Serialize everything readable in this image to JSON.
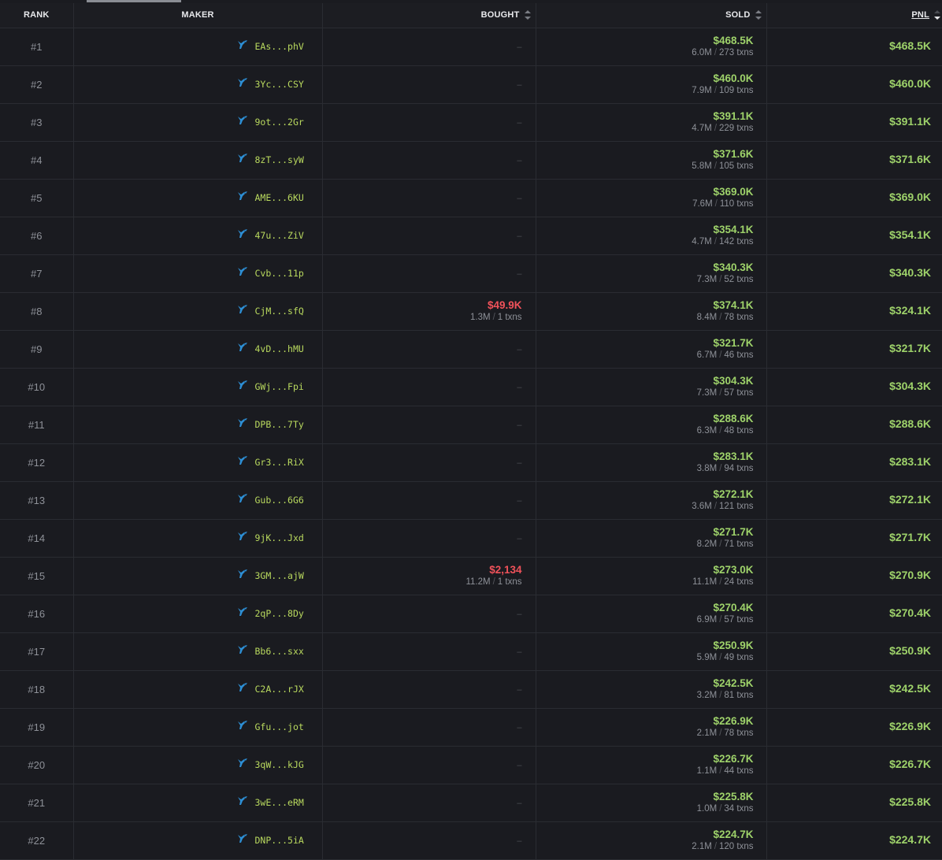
{
  "headers": {
    "rank": "RANK",
    "maker": "MAKER",
    "bought": "BOUGHT",
    "sold": "SOLD",
    "pnl": "PNL"
  },
  "icons": {
    "maker": "whale-icon",
    "sort": "sort-arrows-icon"
  },
  "colors": {
    "background": "#1a1b20",
    "positive": "#9ed26a",
    "negative": "#f0525a",
    "address": "#b9d95e",
    "whale_icon": "#2d8fd5"
  },
  "txn_suffix": "txns",
  "rows": [
    {
      "rank": "#1",
      "maker": "EAs...phV",
      "bought": null,
      "sold": {
        "amount": "$468.5K",
        "tokens": "6.0M",
        "txns": "273"
      },
      "pnl": "$468.5K"
    },
    {
      "rank": "#2",
      "maker": "3Yc...CSY",
      "bought": null,
      "sold": {
        "amount": "$460.0K",
        "tokens": "7.9M",
        "txns": "109"
      },
      "pnl": "$460.0K"
    },
    {
      "rank": "#3",
      "maker": "9ot...2Gr",
      "bought": null,
      "sold": {
        "amount": "$391.1K",
        "tokens": "4.7M",
        "txns": "229"
      },
      "pnl": "$391.1K"
    },
    {
      "rank": "#4",
      "maker": "8zT...syW",
      "bought": null,
      "sold": {
        "amount": "$371.6K",
        "tokens": "5.8M",
        "txns": "105"
      },
      "pnl": "$371.6K"
    },
    {
      "rank": "#5",
      "maker": "AME...6KU",
      "bought": null,
      "sold": {
        "amount": "$369.0K",
        "tokens": "7.6M",
        "txns": "110"
      },
      "pnl": "$369.0K"
    },
    {
      "rank": "#6",
      "maker": "47u...ZiV",
      "bought": null,
      "sold": {
        "amount": "$354.1K",
        "tokens": "4.7M",
        "txns": "142"
      },
      "pnl": "$354.1K"
    },
    {
      "rank": "#7",
      "maker": "Cvb...11p",
      "bought": null,
      "sold": {
        "amount": "$340.3K",
        "tokens": "7.3M",
        "txns": "52"
      },
      "pnl": "$340.3K"
    },
    {
      "rank": "#8",
      "maker": "CjM...sfQ",
      "bought": {
        "amount": "$49.9K",
        "tokens": "1.3M",
        "txns": "1"
      },
      "sold": {
        "amount": "$374.1K",
        "tokens": "8.4M",
        "txns": "78"
      },
      "pnl": "$324.1K"
    },
    {
      "rank": "#9",
      "maker": "4vD...hMU",
      "bought": null,
      "sold": {
        "amount": "$321.7K",
        "tokens": "6.7M",
        "txns": "46"
      },
      "pnl": "$321.7K"
    },
    {
      "rank": "#10",
      "maker": "GWj...Fpi",
      "bought": null,
      "sold": {
        "amount": "$304.3K",
        "tokens": "7.3M",
        "txns": "57"
      },
      "pnl": "$304.3K"
    },
    {
      "rank": "#11",
      "maker": "DPB...7Ty",
      "bought": null,
      "sold": {
        "amount": "$288.6K",
        "tokens": "6.3M",
        "txns": "48"
      },
      "pnl": "$288.6K"
    },
    {
      "rank": "#12",
      "maker": "Gr3...RiX",
      "bought": null,
      "sold": {
        "amount": "$283.1K",
        "tokens": "3.8M",
        "txns": "94"
      },
      "pnl": "$283.1K"
    },
    {
      "rank": "#13",
      "maker": "Gub...6G6",
      "bought": null,
      "sold": {
        "amount": "$272.1K",
        "tokens": "3.6M",
        "txns": "121"
      },
      "pnl": "$272.1K"
    },
    {
      "rank": "#14",
      "maker": "9jK...Jxd",
      "bought": null,
      "sold": {
        "amount": "$271.7K",
        "tokens": "8.2M",
        "txns": "71"
      },
      "pnl": "$271.7K"
    },
    {
      "rank": "#15",
      "maker": "3GM...ajW",
      "bought": {
        "amount": "$2,134",
        "tokens": "11.2M",
        "txns": "1"
      },
      "sold": {
        "amount": "$273.0K",
        "tokens": "11.1M",
        "txns": "24"
      },
      "pnl": "$270.9K"
    },
    {
      "rank": "#16",
      "maker": "2qP...8Dy",
      "bought": null,
      "sold": {
        "amount": "$270.4K",
        "tokens": "6.9M",
        "txns": "57"
      },
      "pnl": "$270.4K"
    },
    {
      "rank": "#17",
      "maker": "Bb6...sxx",
      "bought": null,
      "sold": {
        "amount": "$250.9K",
        "tokens": "5.9M",
        "txns": "49"
      },
      "pnl": "$250.9K"
    },
    {
      "rank": "#18",
      "maker": "C2A...rJX",
      "bought": null,
      "sold": {
        "amount": "$242.5K",
        "tokens": "3.2M",
        "txns": "81"
      },
      "pnl": "$242.5K"
    },
    {
      "rank": "#19",
      "maker": "Gfu...jot",
      "bought": null,
      "sold": {
        "amount": "$226.9K",
        "tokens": "2.1M",
        "txns": "78"
      },
      "pnl": "$226.9K"
    },
    {
      "rank": "#20",
      "maker": "3qW...kJG",
      "bought": null,
      "sold": {
        "amount": "$226.7K",
        "tokens": "1.1M",
        "txns": "44"
      },
      "pnl": "$226.7K"
    },
    {
      "rank": "#21",
      "maker": "3wE...eRM",
      "bought": null,
      "sold": {
        "amount": "$225.8K",
        "tokens": "1.0M",
        "txns": "34"
      },
      "pnl": "$225.8K"
    },
    {
      "rank": "#22",
      "maker": "DNP...5iA",
      "bought": null,
      "sold": {
        "amount": "$224.7K",
        "tokens": "2.1M",
        "txns": "120"
      },
      "pnl": "$224.7K"
    }
  ]
}
